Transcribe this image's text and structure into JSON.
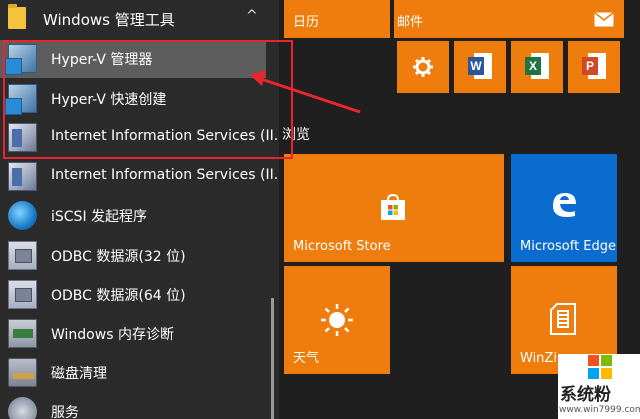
{
  "start_menu": {
    "folder": {
      "label": "Windows 管理工具",
      "chevron": "^"
    },
    "apps": [
      {
        "label": "Hyper-V 管理器",
        "icon": "hyper-v-manager-icon",
        "selected": true
      },
      {
        "label": "Hyper-V 快速创建",
        "icon": "hyper-v-quick-create-icon"
      },
      {
        "label": "Internet Information Services (II...",
        "icon": "iis-manager-icon"
      },
      {
        "label": "Internet Information Services (II...",
        "icon": "iis-manager-icon"
      },
      {
        "label": "iSCSI 发起程序",
        "icon": "iscsi-initiator-icon"
      },
      {
        "label": "ODBC 数据源(32 位)",
        "icon": "odbc-icon"
      },
      {
        "label": "ODBC 数据源(64 位)",
        "icon": "odbc-icon"
      },
      {
        "label": "Windows 内存诊断",
        "icon": "memory-diagnostic-icon"
      },
      {
        "label": "磁盘清理",
        "icon": "disk-cleanup-icon"
      },
      {
        "label": "服务",
        "icon": "services-icon"
      }
    ]
  },
  "tiles": {
    "calendar": {
      "label": "日历"
    },
    "mail": {
      "label": "邮件"
    },
    "browse_group_label": "浏览",
    "store": {
      "label": "Microsoft Store"
    },
    "edge": {
      "label": "Microsoft Edge"
    },
    "weather": {
      "label": "天气"
    },
    "winzip": {
      "label": "WinZip"
    },
    "office": {
      "word": "W",
      "excel": "X",
      "powerpoint": "P"
    }
  },
  "watermark": {
    "brand": "系统粉",
    "url": "www.win7999.com"
  },
  "colors": {
    "tile": "#ef7d0e",
    "edge_tile": "#0b6cd0",
    "highlight": "#e8262d"
  }
}
